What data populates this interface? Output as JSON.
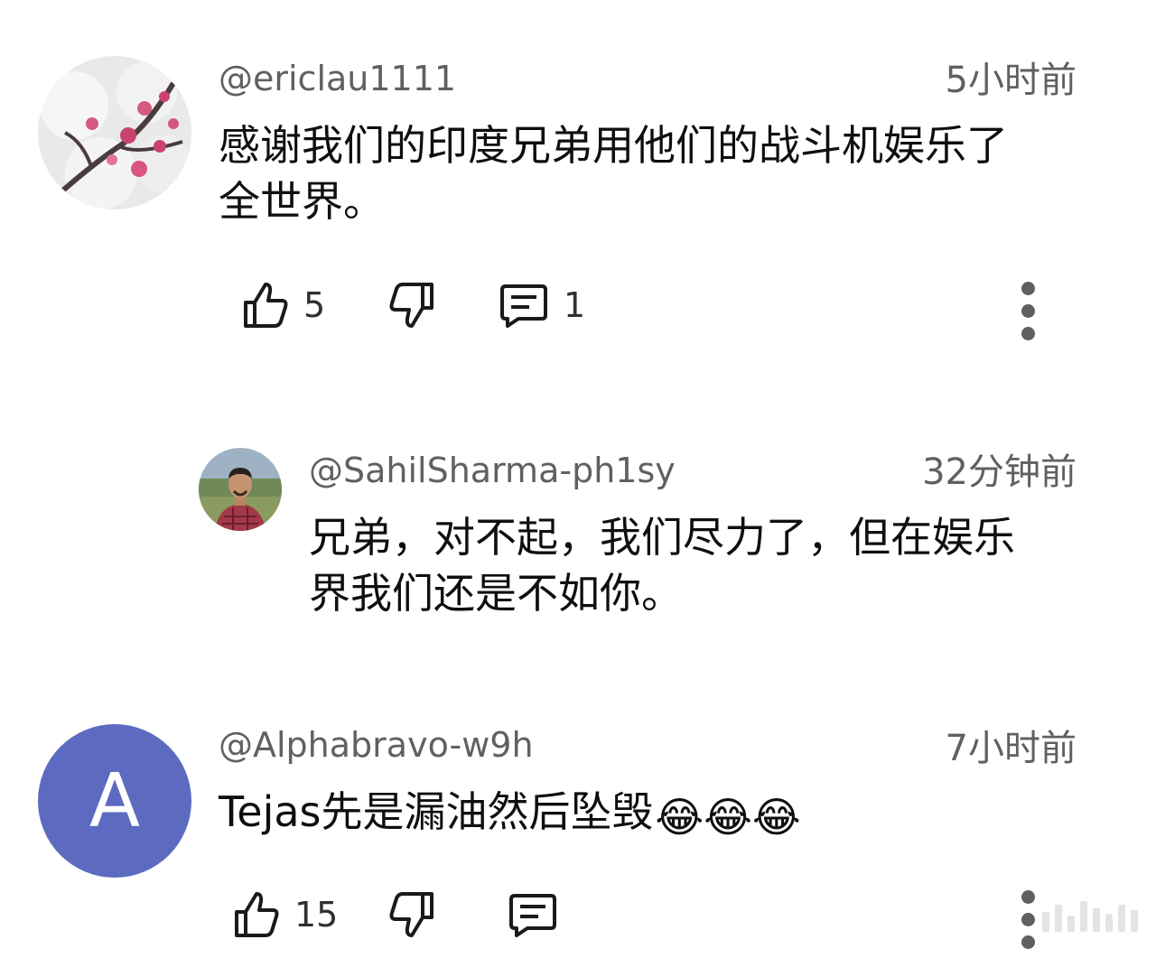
{
  "comments": [
    {
      "handle": "@ericlau1111",
      "time": "5小时前",
      "text_line1": "感谢我们的印度兄弟用他们的战斗机娱乐了",
      "text_line2": "全世界。",
      "likes": "5",
      "replies": "1",
      "avatar_icon": "plum-blossom-snow-photo"
    },
    {
      "handle": "@SahilSharma-ph1sy",
      "time": "32分钟前",
      "text_line1": "兄弟，对不起，我们尽力了，但在娱乐",
      "text_line2": "界我们还是不如你。",
      "avatar_icon": "man-outdoor-photo"
    },
    {
      "handle": "@Alphabravo-w9h",
      "time": "7小时前",
      "text": "Tejas先是漏油然后坠毁",
      "emoji": "😂😂😂",
      "likes": "15",
      "avatar_letter": "A",
      "avatar_color": "#5c6bc0"
    }
  ],
  "colors": {
    "secondary_text": "#606060",
    "primary_text": "#0f0f0f"
  }
}
